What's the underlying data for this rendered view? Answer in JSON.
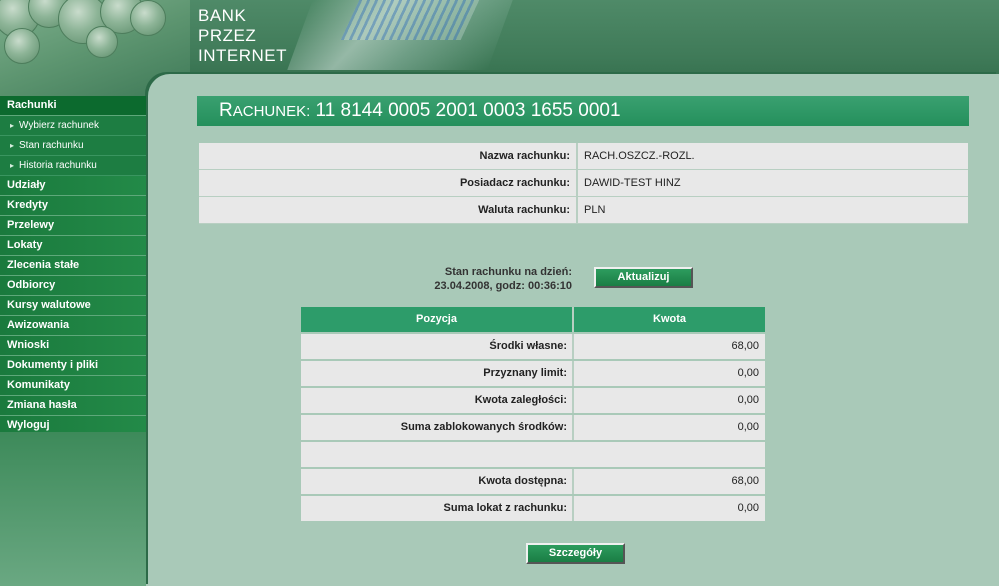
{
  "header": {
    "logo_lines": [
      "BANK",
      "PRZEZ",
      "INTERNET"
    ]
  },
  "sidebar": {
    "items": [
      {
        "label": "Rachunki",
        "type": "main",
        "active": true
      },
      {
        "label": "Wybierz rachunek",
        "type": "sub"
      },
      {
        "label": "Stan rachunku",
        "type": "sub"
      },
      {
        "label": "Historia rachunku",
        "type": "sub"
      },
      {
        "label": "Udziały",
        "type": "main"
      },
      {
        "label": "Kredyty",
        "type": "main"
      },
      {
        "label": "Przelewy",
        "type": "main"
      },
      {
        "label": "Lokaty",
        "type": "main"
      },
      {
        "label": "Zlecenia stałe",
        "type": "main"
      },
      {
        "label": "Odbiorcy",
        "type": "main"
      },
      {
        "label": "Kursy walutowe",
        "type": "main"
      },
      {
        "label": "Awizowania",
        "type": "main"
      },
      {
        "label": "Wnioski",
        "type": "main"
      },
      {
        "label": "Dokumenty i pliki",
        "type": "main"
      },
      {
        "label": "Komunikaty",
        "type": "main"
      },
      {
        "label": "Zmiana hasła",
        "type": "main"
      },
      {
        "label": "Wyloguj",
        "type": "main"
      }
    ]
  },
  "title": {
    "first_letter": "R",
    "rest": "ACHUNEK:",
    "account": "11 8144 0005 2001 0003 1655 0001"
  },
  "info": {
    "rows": [
      {
        "label": "Nazwa rachunku:",
        "value": "RACH.OSZCZ.-ROZL."
      },
      {
        "label": "Posiadacz rachunku:",
        "value": "DAWID-TEST HINZ"
      },
      {
        "label": "Waluta rachunku:",
        "value": "PLN"
      }
    ]
  },
  "status": {
    "line1": "Stan rachunku na dzień:",
    "line2": "23.04.2008, godz: 00:36:10",
    "refresh_label": "Aktualizuj"
  },
  "amounts": {
    "headers": [
      "Pozycja",
      "Kwota"
    ],
    "rows": [
      {
        "label": "Środki własne:",
        "value": "68,00"
      },
      {
        "label": "Przyznany limit:",
        "value": "0,00"
      },
      {
        "label": "Kwota zaległości:",
        "value": "0,00"
      },
      {
        "label": "Suma zablokowanych środków:",
        "value": "0,00"
      }
    ],
    "rows_after": [
      {
        "label": "Kwota dostępna:",
        "value": "68,00"
      },
      {
        "label": "Suma lokat z rachunku:",
        "value": "0,00"
      }
    ]
  },
  "details_label": "Szczegóły",
  "colors": {
    "menu_green": "#1a7a3d",
    "accent_green": "#2d9c6a",
    "background": "#a9c9b8"
  }
}
